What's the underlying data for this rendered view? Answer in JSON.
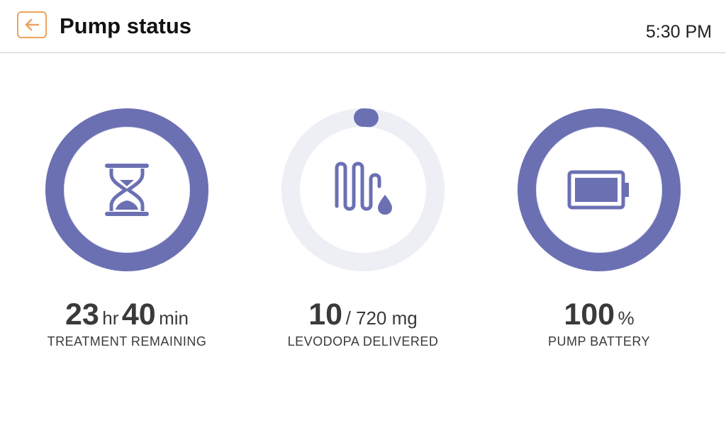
{
  "header": {
    "title": "Pump status",
    "time": "5:30 PM",
    "back_icon": "arrow-left-icon"
  },
  "colors": {
    "accent": "#6b70b3",
    "track": "#eeeff5",
    "back_border": "#f0a15c",
    "text": "#3a3a3a"
  },
  "tiles": [
    {
      "icon": "hourglass-icon",
      "progress": 1.0,
      "hours": "23",
      "hours_unit": "hr",
      "minutes": "40",
      "minutes_unit": "min",
      "label": "TREATMENT REMAINING"
    },
    {
      "icon": "tube-drop-icon",
      "progress": 0.0139,
      "value": "10",
      "total": "/ 720 mg",
      "label": "LEVODOPA DELIVERED"
    },
    {
      "icon": "battery-icon",
      "progress": 1.0,
      "value": "100",
      "unit": "%",
      "label": "PUMP BATTERY"
    }
  ]
}
